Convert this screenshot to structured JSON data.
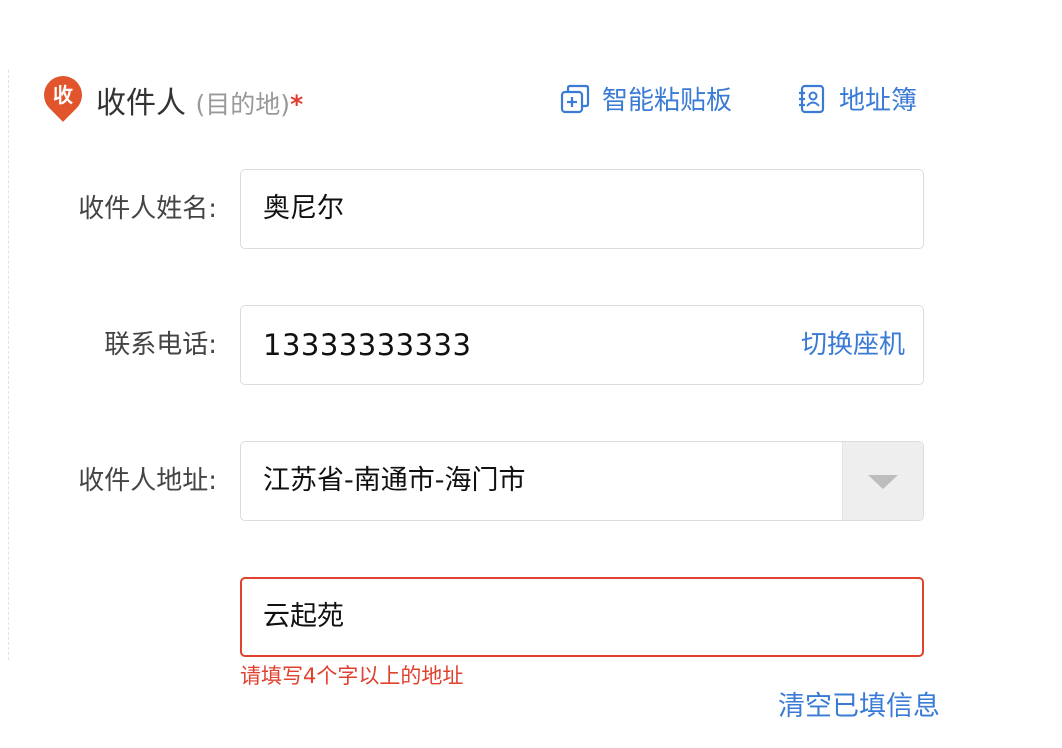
{
  "header": {
    "badge": "收",
    "title": "收件人",
    "subtitle": "(目的地)",
    "required_mark": "*",
    "paste_board": "智能粘贴板",
    "address_book": "地址簿"
  },
  "form": {
    "name": {
      "label": "收件人姓名:",
      "value": "奥尼尔"
    },
    "phone": {
      "label": "联系电话:",
      "value": "13333333333",
      "switch_label": "切换座机"
    },
    "region": {
      "label": "收件人地址:",
      "value": "江苏省-南通市-海门市"
    },
    "detail": {
      "value": "云起苑",
      "error": "请填写4个字以上的地址"
    }
  },
  "clear_label": "清空已填信息",
  "colors": {
    "accent": "#3a7bd5",
    "error": "#e0422f",
    "badge": "#e2542c"
  }
}
